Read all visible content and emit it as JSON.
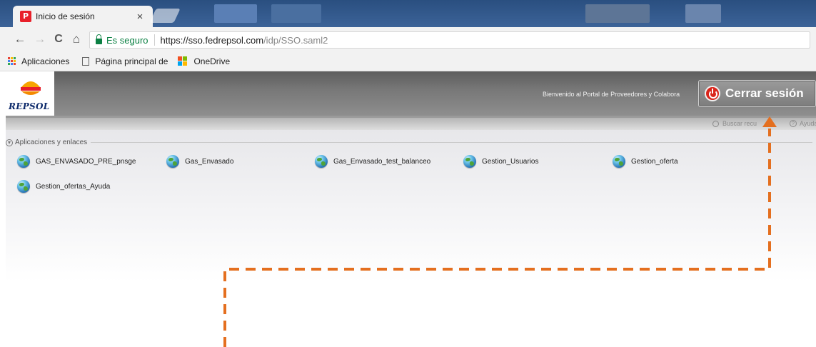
{
  "browser": {
    "tab_title": "Inicio de sesión",
    "tab_favicon": "P",
    "tab_close": "×",
    "secure_label": "Es seguro",
    "url_main": "https://sso.fedrepsol.com",
    "url_path": "/idp/SSO.saml2",
    "nav_back": "←",
    "nav_forward": "→",
    "nav_reload": "C",
    "nav_home": "⌂",
    "bookmarks": {
      "apps": "Aplicaciones",
      "page": "Página principal de",
      "onedrive": "OneDrive"
    }
  },
  "portal": {
    "logo_text": "REPSOL",
    "welcome": "Bienvenido al Portal de Proveedores y Colabora",
    "logout_label": "Cerrar sesión",
    "search_link": "Buscar recu",
    "help_link": "Ayuda",
    "help_icon_glyph": "?",
    "section_title": "Aplicaciones y enlaces",
    "apps": [
      "GAS_ENVASADO_PRE_pnsge",
      "Gas_Envasado",
      "Gas_Envasado_test_balanceo",
      "Gestion_Usuarios",
      "Gestion_oferta",
      "Gestion_ofertas_Ayuda"
    ]
  },
  "colors": {
    "annotation": "#e46f1f",
    "brand_red": "#d9261c",
    "secure_green": "#0b8043",
    "logo_blue": "#0d2a6b"
  },
  "icons": {
    "app_icon": "globe-icon",
    "logout_icon": "power-icon",
    "section_toggle": "chevron-down-icon",
    "search": "search-icon",
    "help": "help-icon"
  }
}
